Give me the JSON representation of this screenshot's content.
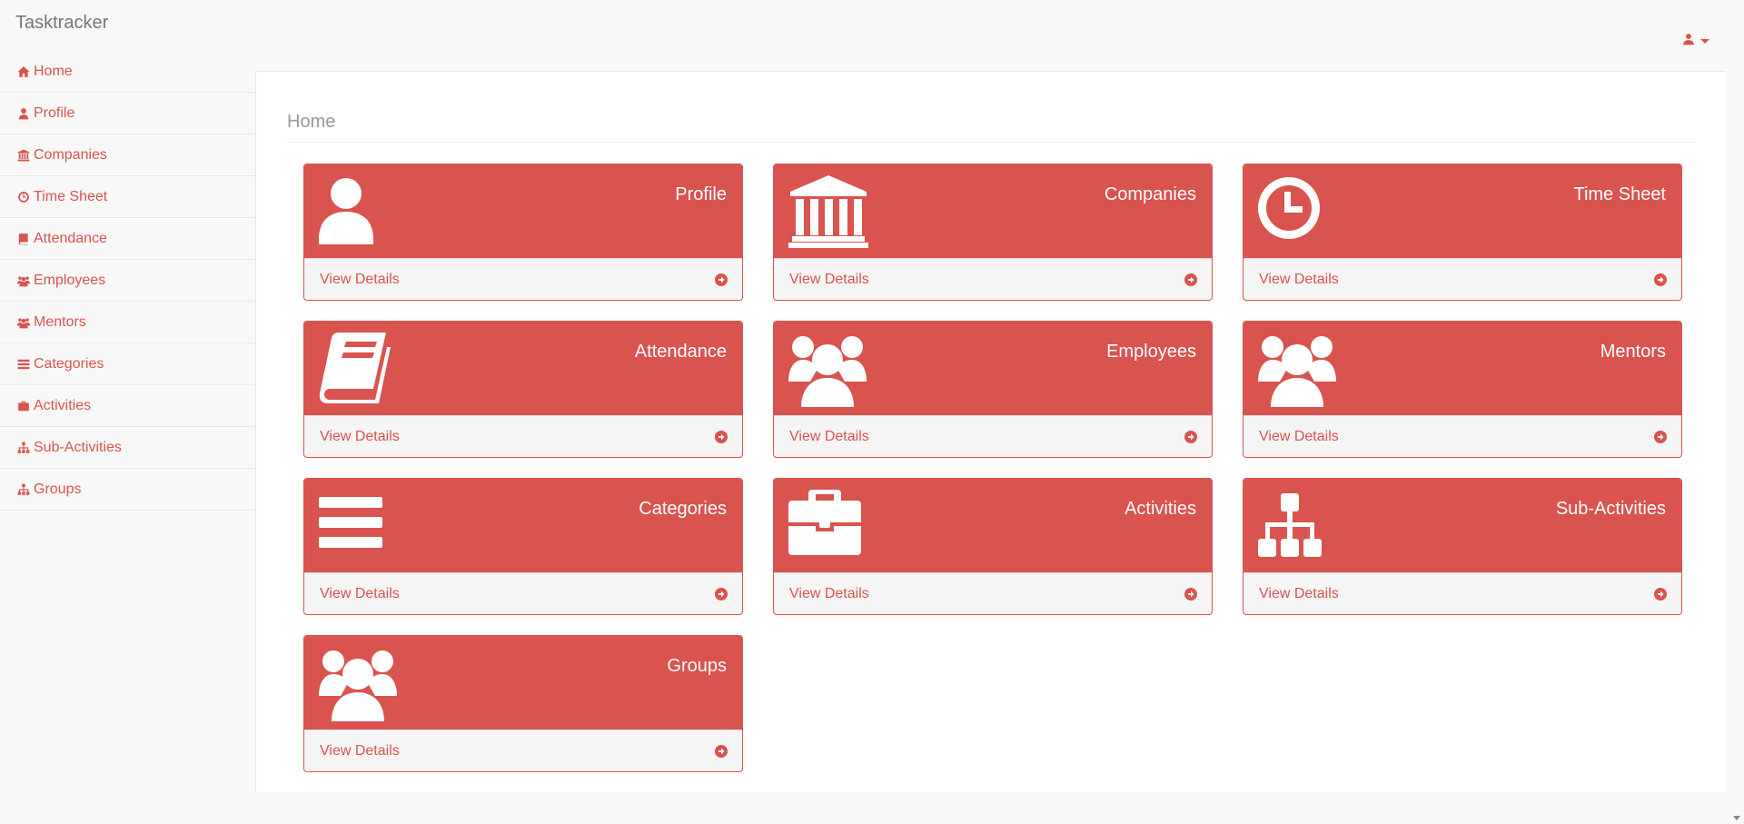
{
  "app": {
    "brand": "Tasktracker"
  },
  "header": {
    "user_icon": "user-icon"
  },
  "sidebar": {
    "items": [
      {
        "label": "Home",
        "icon": "home-icon"
      },
      {
        "label": "Profile",
        "icon": "user-icon"
      },
      {
        "label": "Companies",
        "icon": "bank-icon"
      },
      {
        "label": "Time Sheet",
        "icon": "clock-icon"
      },
      {
        "label": "Attendance",
        "icon": "book-icon"
      },
      {
        "label": "Employees",
        "icon": "users-icon"
      },
      {
        "label": "Mentors",
        "icon": "users-icon"
      },
      {
        "label": "Categories",
        "icon": "bars-icon"
      },
      {
        "label": "Activities",
        "icon": "briefcase-icon"
      },
      {
        "label": "Sub-Activities",
        "icon": "sitemap-icon"
      },
      {
        "label": "Groups",
        "icon": "sitemap-icon"
      }
    ]
  },
  "main": {
    "title": "Home",
    "panels": [
      {
        "title": "Profile",
        "icon": "user-icon",
        "link": "View Details"
      },
      {
        "title": "Companies",
        "icon": "bank-icon",
        "link": "View Details"
      },
      {
        "title": "Time Sheet",
        "icon": "clock-icon",
        "link": "View Details"
      },
      {
        "title": "Attendance",
        "icon": "book-icon",
        "link": "View Details"
      },
      {
        "title": "Employees",
        "icon": "users-icon",
        "link": "View Details"
      },
      {
        "title": "Mentors",
        "icon": "users-icon",
        "link": "View Details"
      },
      {
        "title": "Categories",
        "icon": "bars-icon",
        "link": "View Details"
      },
      {
        "title": "Activities",
        "icon": "briefcase-icon",
        "link": "View Details"
      },
      {
        "title": "Sub-Activities",
        "icon": "sitemap-icon",
        "link": "View Details"
      },
      {
        "title": "Groups",
        "icon": "users-icon",
        "link": "View Details"
      }
    ]
  },
  "colors": {
    "accent": "#d9534f",
    "panel_footer": "#f5f5f5",
    "page_bg": "#f8f8f8"
  }
}
